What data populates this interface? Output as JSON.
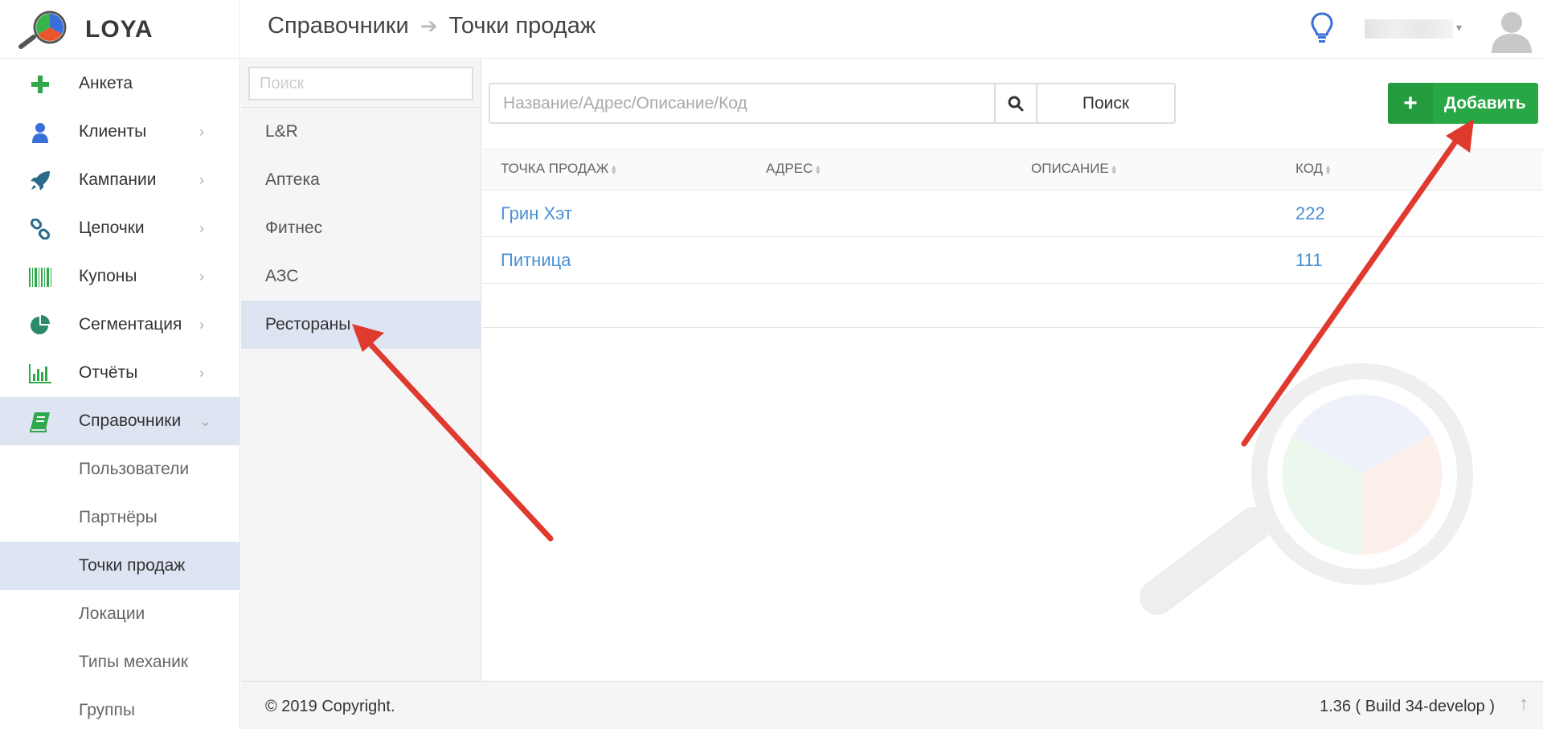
{
  "app": {
    "name": "LOYA"
  },
  "header": {
    "breadcrumb": [
      "Справочники",
      "Точки продаж"
    ],
    "breadcrumb_separator": "➔"
  },
  "sidebar": {
    "items": [
      {
        "label": "Анкета",
        "icon": "plus-icon",
        "chevron": ""
      },
      {
        "label": "Клиенты",
        "icon": "user-icon",
        "chevron": "›"
      },
      {
        "label": "Кампании",
        "icon": "rocket-icon",
        "chevron": "›"
      },
      {
        "label": "Цепочки",
        "icon": "chain-link-icon",
        "chevron": "›"
      },
      {
        "label": "Купоны",
        "icon": "barcode-icon",
        "chevron": "›"
      },
      {
        "label": "Сегментация",
        "icon": "pie-chart-icon",
        "chevron": "›"
      },
      {
        "label": "Отчёты",
        "icon": "bar-chart-icon",
        "chevron": "›"
      },
      {
        "label": "Справочники",
        "icon": "book-icon",
        "chevron": "⌄"
      }
    ],
    "subitems": [
      "Пользователи",
      "Партнёры",
      "Точки продаж",
      "Локации",
      "Типы механик",
      "Группы"
    ]
  },
  "categories": {
    "search_placeholder": "Поиск",
    "items": [
      "L&R",
      "Аптека",
      "Фитнес",
      "АЗС",
      "Рестораны"
    ]
  },
  "toolbar": {
    "search_placeholder": "Название/Адрес/Описание/Код",
    "search_button": "Поиск",
    "add_button": "Добавить"
  },
  "table": {
    "columns": [
      "ТОЧКА ПРОДАЖ",
      "АДРЕС",
      "ОПИСАНИЕ",
      "КОД"
    ],
    "rows": [
      {
        "name": "Грин Хэт",
        "address": "",
        "description": "",
        "code": "222"
      },
      {
        "name": "Питница",
        "address": "",
        "description": "",
        "code": "111"
      }
    ]
  },
  "footer": {
    "copyright": "© 2019 Copyright.",
    "version": "1.36 ( Build 34-develop )"
  },
  "colors": {
    "accent_green": "#27a844",
    "active_bg": "#dde4f2",
    "link_blue": "#4a8fd4",
    "annotation_red": "#e03a2f"
  }
}
